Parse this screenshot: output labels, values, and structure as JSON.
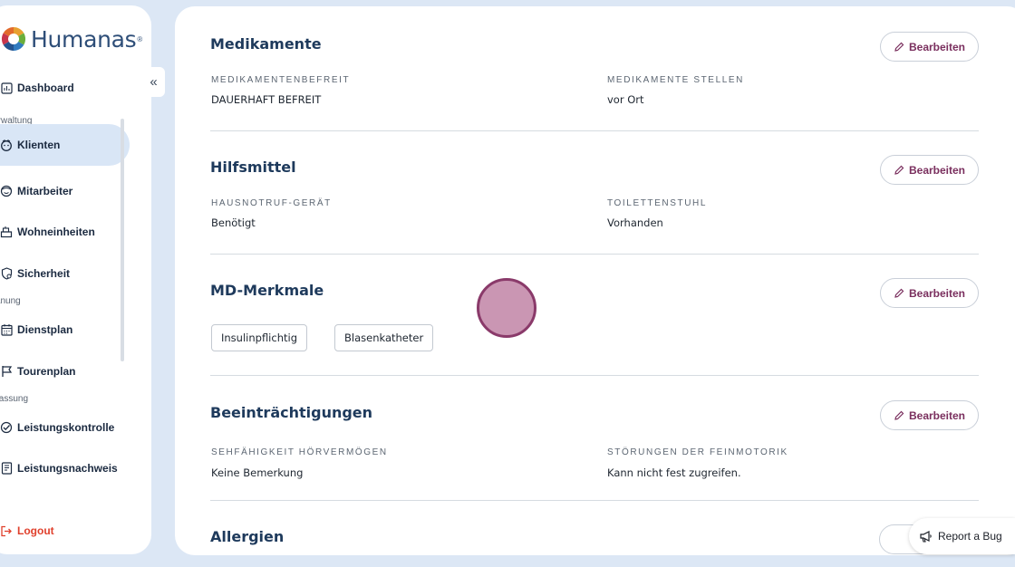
{
  "app": {
    "logo_text": "Humanas",
    "logo_reg": "®"
  },
  "sidebar": {
    "items": [
      {
        "label": "Dashboard",
        "icon": "dashboard-icon"
      },
      {
        "label": "Klienten",
        "icon": "klienten-icon",
        "active": true
      },
      {
        "label": "Mitarbeiter",
        "icon": "mitarbeiter-icon"
      },
      {
        "label": "Wohneinheiten",
        "icon": "wohneinheiten-icon"
      },
      {
        "label": "Sicherheit",
        "icon": "shield-icon"
      },
      {
        "label": "Dienstplan",
        "icon": "calendar-icon"
      },
      {
        "label": "Tourenplan",
        "icon": "flag-icon"
      },
      {
        "label": "Leistungskontrolle",
        "icon": "check-circle-icon"
      },
      {
        "label": "Leistungsnachweis",
        "icon": "document-list-icon"
      }
    ],
    "sections": {
      "verwaltung": "Verwaltung",
      "planung": "Planung",
      "erfassung": "Erfassung"
    },
    "logout": "Logout",
    "collapse": "«"
  },
  "main": {
    "edit_label": "Bearbeiten",
    "medikamente": {
      "title": "Medikamente",
      "left_label": "MEDIKAMENTENBEFREIT",
      "left_value": "DAUERHAFT BEFREIT",
      "right_label": "MEDIKAMENTE STELLEN",
      "right_value": "vor Ort"
    },
    "hilfsmittel": {
      "title": "Hilfsmittel",
      "left_label": "HAUSNOTRUF-GERÄT",
      "left_value": "Benötigt",
      "right_label": "TOILETTENSTUHL",
      "right_value": "Vorhanden"
    },
    "md": {
      "title": "MD-Merkmale",
      "tags": [
        "Insulinpflichtig",
        "Blasenkatheter"
      ]
    },
    "beeintraechtigungen": {
      "title": "Beeinträchtigungen",
      "left_label": "SEHFÄHIGKEIT HÖRVERMÖGEN",
      "left_value": "Keine Bemerkung",
      "right_label": "STÖRUNGEN DER FEINMOTORIK",
      "right_value": "Kann nicht fest zugreifen."
    },
    "allergien": {
      "title": "Allergien"
    }
  },
  "bug_report": {
    "label": "Report a Bug"
  },
  "colors": {
    "accent": "#7a2f5e",
    "title": "#1e3a5c",
    "background": "#dce7f5",
    "logout": "#e0402c"
  }
}
